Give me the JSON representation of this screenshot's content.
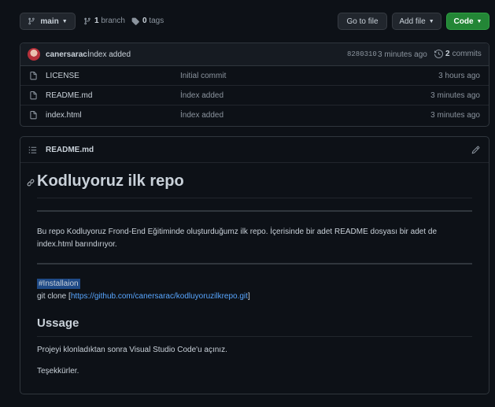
{
  "toolbar": {
    "branch_label": "main",
    "branches_count": "1",
    "branches_label": "branch",
    "tags_count": "0",
    "tags_label": "tags",
    "goto_file": "Go to file",
    "add_file": "Add file",
    "code": "Code"
  },
  "commit": {
    "author": "canersarac",
    "message": "İndex added",
    "hash": "8280310",
    "time": "3 minutes ago",
    "commits_count": "2",
    "commits_label": "commits"
  },
  "files": [
    {
      "name": "LICENSE",
      "message": "Initial commit",
      "time": "3 hours ago"
    },
    {
      "name": "README.md",
      "message": "İndex added",
      "time": "3 minutes ago"
    },
    {
      "name": "index.html",
      "message": "İndex added",
      "time": "3 minutes ago"
    }
  ],
  "readme": {
    "filename": "README.md",
    "title": "Kodluyoruz ilk repo",
    "paragraph": "Bu repo Kodluyoruz Frond-End Eğitiminde oluşturduğumz ilk repo. İçerisinde bir adet README dosyası bir adet de index.html barındırıyor.",
    "install_heading": "#Installaion",
    "clone_prefix": "git clone [",
    "clone_url": "https://github.com/canersarac/kodluyoruzilkrepo.git",
    "clone_suffix": "]",
    "usage_heading": "Ussage",
    "usage_text": "Projeyi klonladıktan sonra Visual Studio Code'u açınız.",
    "thanks": "Teşekkürler."
  },
  "colors": {
    "background": "#0d1117",
    "border": "#30363d",
    "green": "#238636",
    "link": "#58a6ff"
  }
}
